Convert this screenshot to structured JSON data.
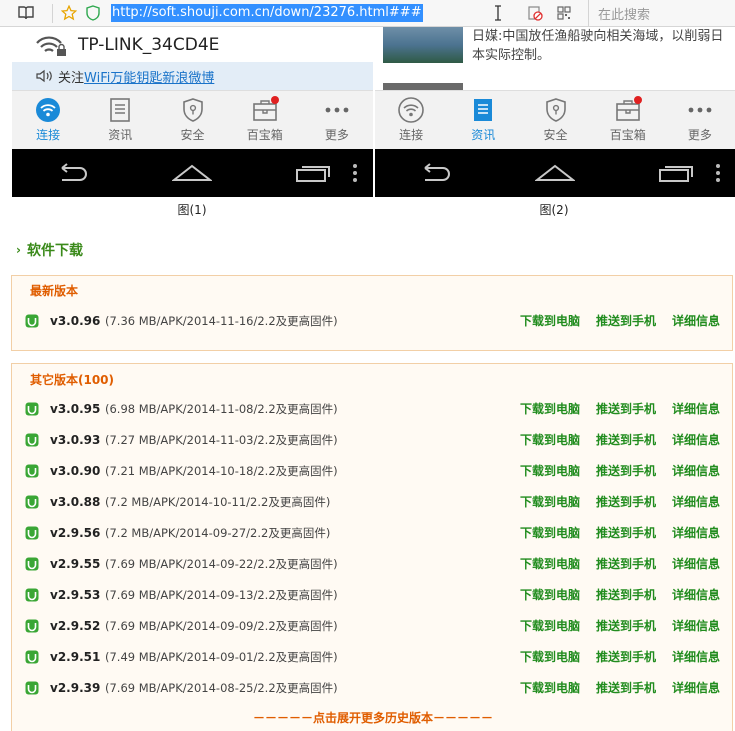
{
  "browser": {
    "url": "http://soft.shouji.com.cn/down/23276.html###",
    "search_placeholder": "在此搜索"
  },
  "phone1": {
    "wifi_name": "TP-LINK_34CD4E",
    "notice_prefix": "关注",
    "notice_link": "WiFi万能钥匙新浪微博",
    "tabs": [
      "连接",
      "资讯",
      "安全",
      "百宝箱",
      "更多"
    ],
    "caption": "图(1)"
  },
  "phone2": {
    "news_text": "日媒:中国放任渔船驶向相关海域，以削弱日本实际控制。",
    "tabs": [
      "连接",
      "资讯",
      "安全",
      "百宝箱",
      "更多"
    ],
    "caption": "图(2)"
  },
  "section": {
    "title": "软件下载"
  },
  "latest": {
    "title": "最新版本",
    "row": {
      "version": "v3.0.96",
      "meta": "(7.36 MB/APK/2014-11-16/2.2及更高固件)"
    }
  },
  "other": {
    "title": "其它版本(100)",
    "rows": [
      {
        "version": "v3.0.95",
        "meta": "(6.98 MB/APK/2014-11-08/2.2及更高固件)"
      },
      {
        "version": "v3.0.93",
        "meta": "(7.27 MB/APK/2014-11-03/2.2及更高固件)"
      },
      {
        "version": "v3.0.90",
        "meta": "(7.21 MB/APK/2014-10-18/2.2及更高固件)"
      },
      {
        "version": "v3.0.88",
        "meta": "(7.2 MB/APK/2014-10-11/2.2及更高固件)"
      },
      {
        "version": "v2.9.56",
        "meta": "(7.2 MB/APK/2014-09-27/2.2及更高固件)"
      },
      {
        "version": "v2.9.55",
        "meta": "(7.69 MB/APK/2014-09-22/2.2及更高固件)"
      },
      {
        "version": "v2.9.53",
        "meta": "(7.69 MB/APK/2014-09-13/2.2及更高固件)"
      },
      {
        "version": "v2.9.52",
        "meta": "(7.69 MB/APK/2014-09-09/2.2及更高固件)"
      },
      {
        "version": "v2.9.51",
        "meta": "(7.49 MB/APK/2014-09-01/2.2及更高固件)"
      },
      {
        "version": "v2.9.39",
        "meta": "(7.69 MB/APK/2014-08-25/2.2及更高固件)"
      }
    ],
    "more_link": "－－－－－点击展开更多历史版本－－－－－"
  },
  "actions": {
    "download_pc": "下载到电脑",
    "push_phone": "推送到手机",
    "details": "详细信息"
  },
  "colors": {
    "action_green": "#218c1e",
    "accent_orange": "#e05d00",
    "box_bg": "#fffaf3",
    "box_border": "#f2cfa6",
    "tab_active": "#1a8ad8",
    "url_highlight": "#3390ff"
  }
}
